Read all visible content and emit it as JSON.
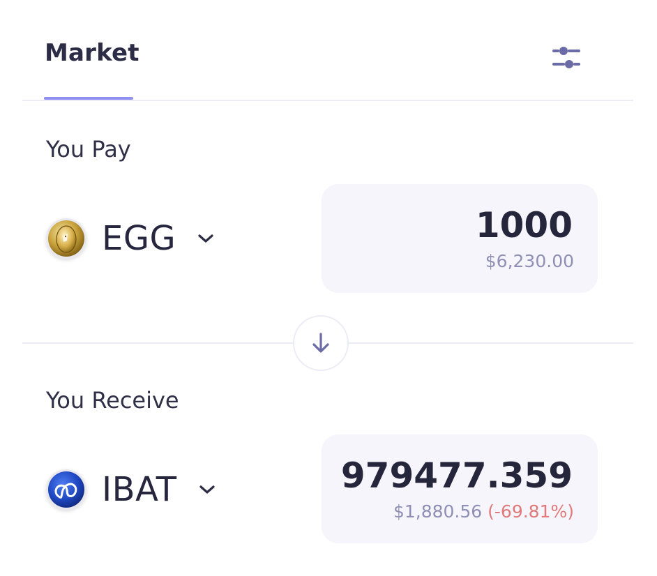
{
  "tabs": {
    "market_label": "Market"
  },
  "pay": {
    "label": "You Pay",
    "token_symbol": "EGG",
    "amount": "1000",
    "usd_value": "$6,230.00"
  },
  "receive": {
    "label": "You Receive",
    "token_symbol": "IBAT",
    "amount": "979477.359",
    "usd_value": "$1,880.56",
    "price_impact": "(-69.81%)"
  },
  "icons": {
    "settings": "sliders-icon",
    "swap": "arrow-down-icon",
    "dropdown": "chevron-down-icon",
    "pay_token_logo": "egg-token-logo",
    "receive_token_logo": "ibat-token-logo"
  },
  "colors": {
    "accent": "#8f8ff0",
    "text_primary": "#26263e",
    "text_secondary": "#8f8fb6",
    "negative": "#e07a7a",
    "input_background": "#f5f5fb",
    "divider": "#ececf6"
  }
}
